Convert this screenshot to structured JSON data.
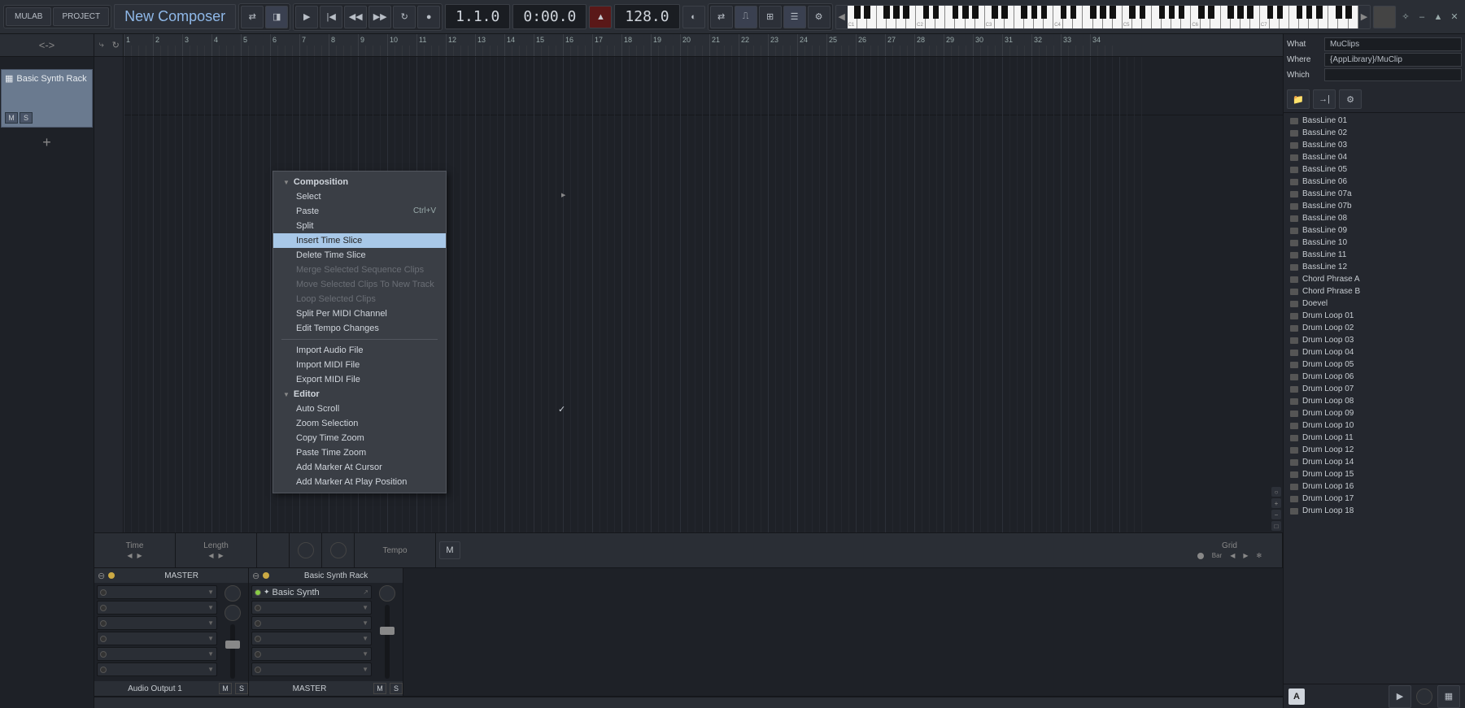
{
  "toolbar": {
    "mulab": "MULAB",
    "project": "PROJECT",
    "title": "New Composer",
    "position": "1.1.0",
    "time": "0:00.0",
    "tempo": "128.0"
  },
  "track": {
    "name": "Basic Synth Rack",
    "mute": "M",
    "solo": "S"
  },
  "ruler": {
    "bars": [
      "1",
      "2",
      "3",
      "4",
      "5",
      "6",
      "7",
      "8",
      "9",
      "10",
      "11",
      "12",
      "13",
      "14",
      "15",
      "16",
      "17",
      "18",
      "19",
      "20",
      "21",
      "22",
      "23",
      "24",
      "25",
      "26",
      "27",
      "28",
      "29",
      "30",
      "31",
      "32",
      "33",
      "34"
    ]
  },
  "context_menu": {
    "section1": "Composition",
    "select": "Select",
    "paste": "Paste",
    "paste_shortcut": "Ctrl+V",
    "split": "Split",
    "insert_time": "Insert Time Slice",
    "delete_time": "Delete Time Slice",
    "merge": "Merge Selected Sequence Clips",
    "move_new": "Move Selected Clips To New Track",
    "loop_sel": "Loop Selected Clips",
    "split_midi": "Split Per MIDI Channel",
    "edit_tempo": "Edit Tempo Changes",
    "import_audio": "Import Audio File",
    "import_midi": "Import MIDI File",
    "export_midi": "Export MIDI File",
    "section2": "Editor",
    "auto_scroll": "Auto Scroll",
    "zoom_sel": "Zoom Selection",
    "copy_zoom": "Copy Time Zoom",
    "paste_zoom": "Paste Time Zoom",
    "marker_cursor": "Add Marker At Cursor",
    "marker_play": "Add Marker At Play Position"
  },
  "info_bar": {
    "time": "Time",
    "length": "Length",
    "tempo": "Tempo",
    "m_btn": "M",
    "grid": "Grid",
    "bar": "Bar"
  },
  "mixer": {
    "master": "MASTER",
    "basic_synth_rack": "Basic Synth Rack",
    "basic_synth": "Basic Synth",
    "audio_out": "Audio Output 1",
    "m": "M",
    "s": "S"
  },
  "browser": {
    "what_label": "What",
    "what_value": "MuClips",
    "where_label": "Where",
    "where_value": "{AppLibrary}/MuClip",
    "which_label": "Which",
    "which_value": "",
    "letter": "A",
    "items": [
      "BassLine 01",
      "BassLine 02",
      "BassLine 03",
      "BassLine 04",
      "BassLine 05",
      "BassLine 06",
      "BassLine 07a",
      "BassLine 07b",
      "BassLine 08",
      "BassLine 09",
      "BassLine 10",
      "BassLine 11",
      "BassLine 12",
      "Chord Phrase A",
      "Chord Phrase B",
      "Doevel",
      "Drum Loop 01",
      "Drum Loop 02",
      "Drum Loop 03",
      "Drum Loop 04",
      "Drum Loop 05",
      "Drum Loop 06",
      "Drum Loop 07",
      "Drum Loop 08",
      "Drum Loop 09",
      "Drum Loop 10",
      "Drum Loop 11",
      "Drum Loop 12",
      "Drum Loop 14",
      "Drum Loop 15",
      "Drum Loop 16",
      "Drum Loop 17",
      "Drum Loop 18"
    ]
  },
  "piano_octaves": [
    "C1",
    "C2",
    "C3",
    "C4",
    "C5",
    "C6",
    "C7"
  ]
}
